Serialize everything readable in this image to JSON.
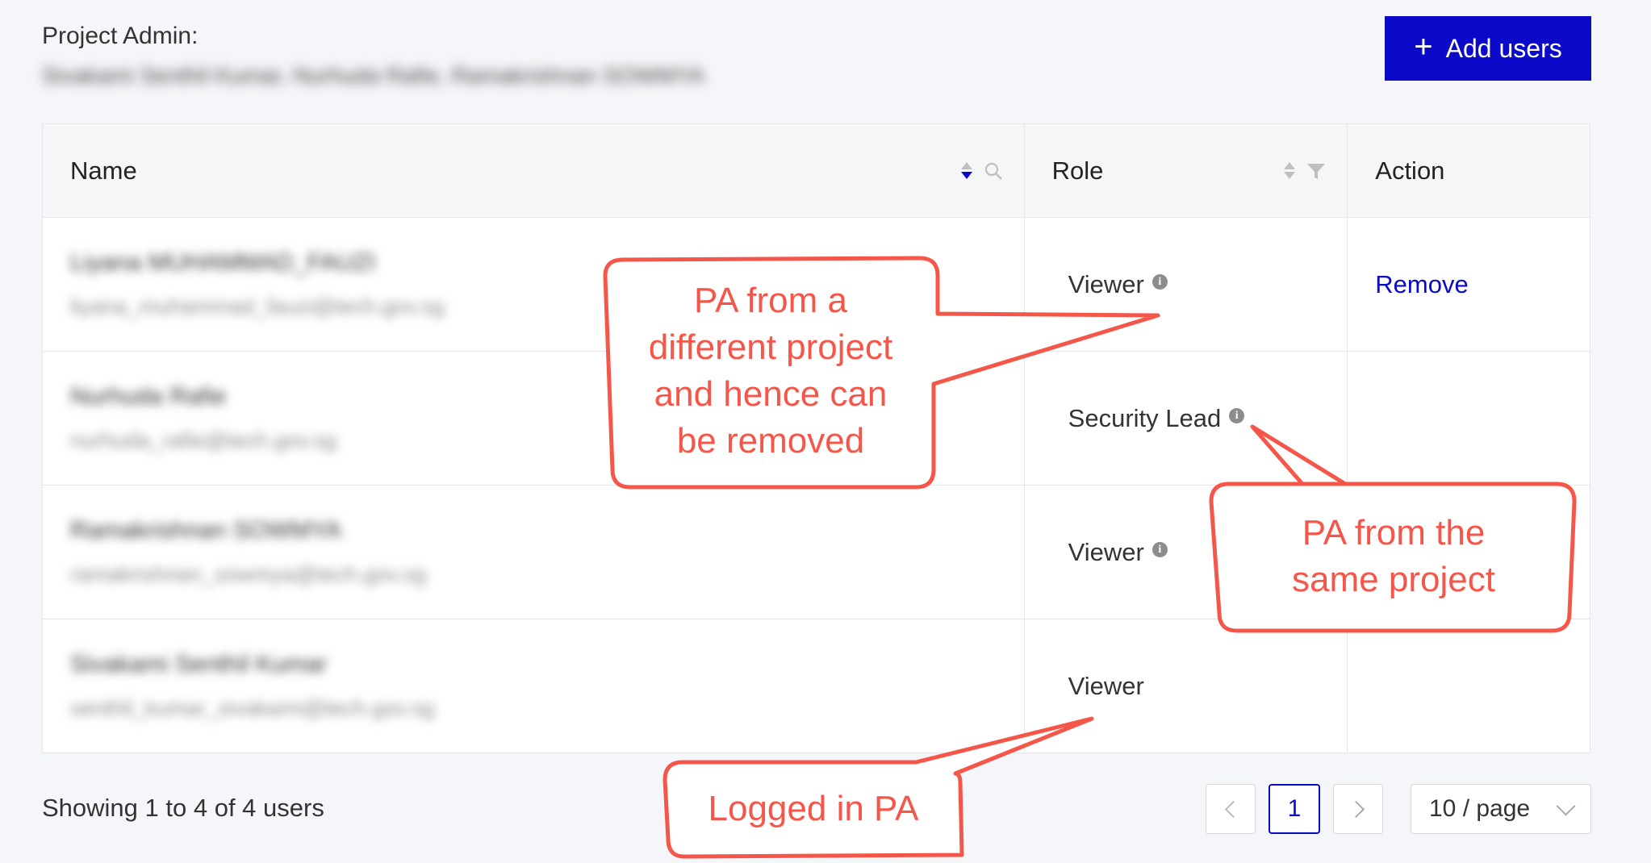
{
  "header": {
    "admin_label": "Project Admin:",
    "admin_names": "Sivakami Senthil Kumar, Nurhuda Rafie, Ramakrishnan SOWMYA",
    "add_button_label": "Add users"
  },
  "table": {
    "columns": {
      "name": "Name",
      "role": "Role",
      "action": "Action"
    },
    "rows": [
      {
        "name": "Liyana MUHAMMAD_FAUZI",
        "email": "liyana_muhammad_fauzi@tech.gov.sg",
        "role": "Viewer",
        "action": "Remove"
      },
      {
        "name": "Nurhuda Rafie",
        "email": "nurhuda_rafie@tech.gov.sg",
        "role": "Security Lead",
        "action": ""
      },
      {
        "name": "Ramakrishnan SOWMYA",
        "email": "ramakrishnan_sowmya@tech.gov.sg",
        "role": "Viewer",
        "action": ""
      },
      {
        "name": "Sivakami Senthil Kumar",
        "email": "senthil_kumar_sivakami@tech.gov.sg",
        "role": "Viewer",
        "action": ""
      }
    ]
  },
  "footer": {
    "summary": "Showing 1 to 4 of 4 users",
    "current_page": "1",
    "page_size": "10 / page"
  },
  "callouts": {
    "first": [
      "PA from a",
      "different project",
      "and hence can",
      "be removed"
    ],
    "second": [
      "PA from the",
      "same project"
    ],
    "third": "Logged in PA"
  },
  "colors": {
    "accent": "#0a0ac8",
    "callout": "#f4574a",
    "background": "#f4f6f9"
  },
  "icons": {
    "sort": "sort-icon",
    "search": "search-icon",
    "filter": "filter-icon",
    "info": "info-icon",
    "plus": "plus-icon"
  }
}
